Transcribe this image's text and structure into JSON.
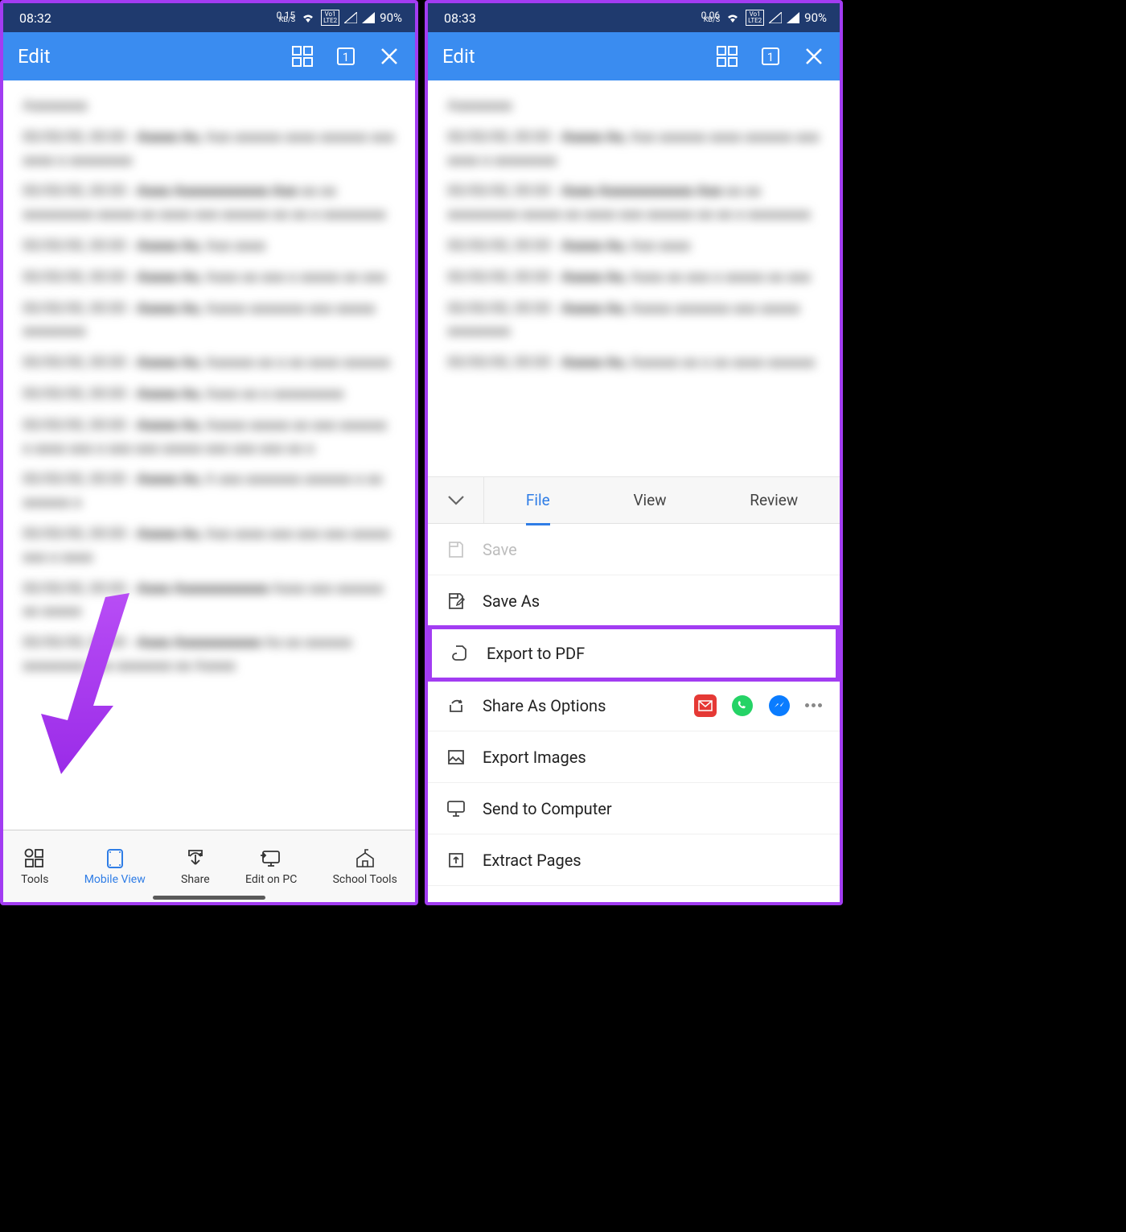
{
  "left": {
    "status": {
      "time": "08:32",
      "net": "0.15",
      "unit": "KB/S",
      "lte_top": "Vo1",
      "lte_bot": "LTE2",
      "battery": "90%"
    },
    "appbar": {
      "title": "Edit",
      "badge": "1"
    },
    "nav": [
      {
        "label": "Tools"
      },
      {
        "label": "Mobile View"
      },
      {
        "label": "Share"
      },
      {
        "label": "Edit on PC"
      },
      {
        "label": "School Tools"
      }
    ]
  },
  "right": {
    "status": {
      "time": "08:33",
      "net": "0.06",
      "unit": "KB/S",
      "lte_top": "Vo1",
      "lte_bot": "LTE2",
      "battery": "90%"
    },
    "appbar": {
      "title": "Edit",
      "badge": "1"
    },
    "tabs": {
      "file": "File",
      "view": "View",
      "review": "Review"
    },
    "menu": {
      "save": "Save",
      "save_as": "Save As",
      "export_pdf": "Export to PDF",
      "share_as": "Share As Options",
      "export_images": "Export Images",
      "send_computer": "Send to Computer",
      "extract_pages": "Extract Pages"
    }
  }
}
